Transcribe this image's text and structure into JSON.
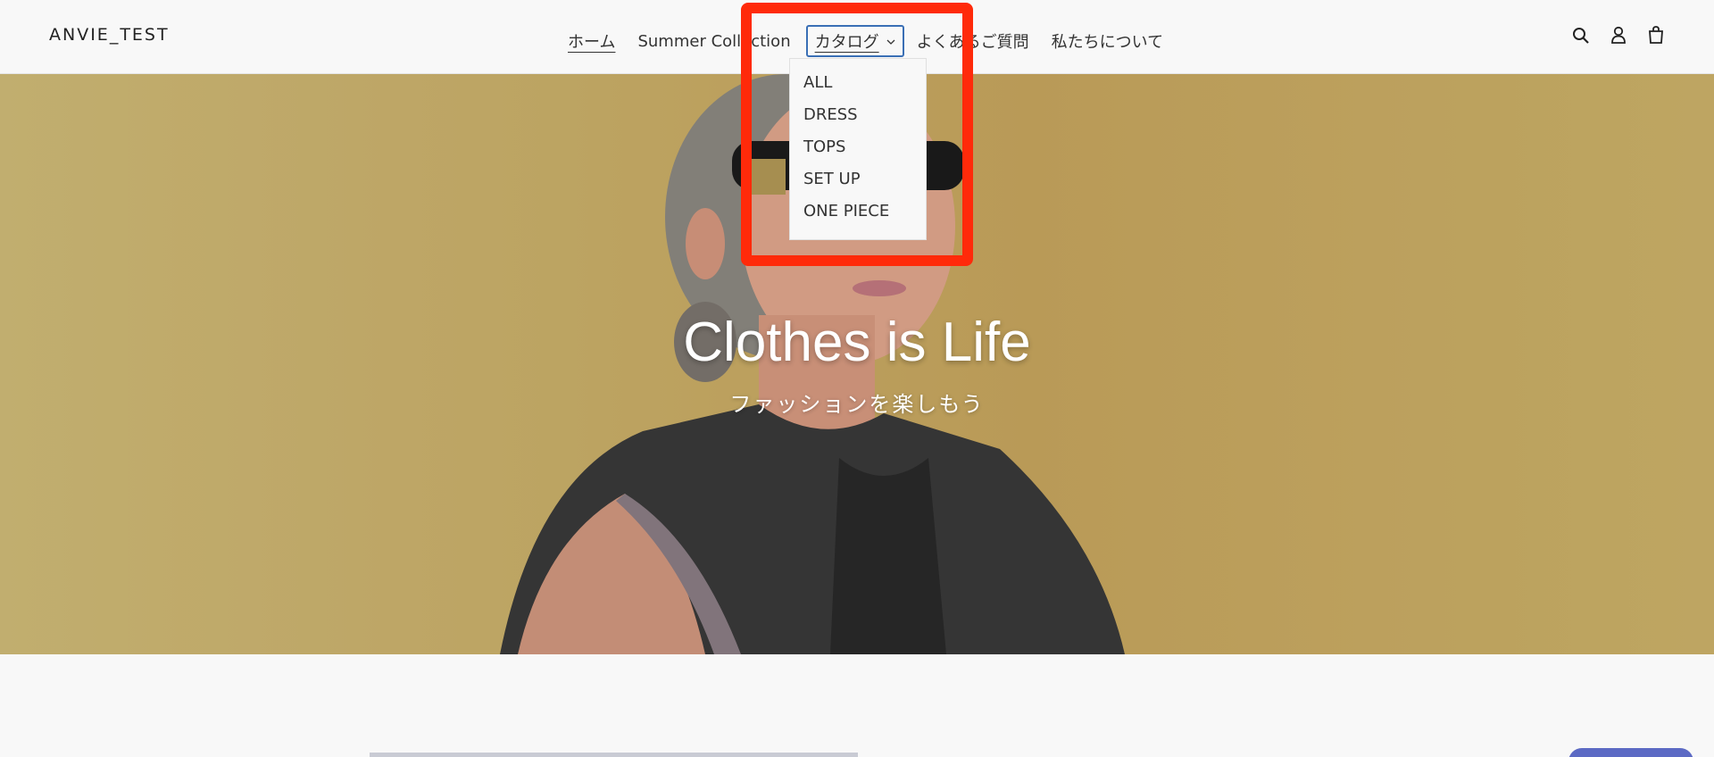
{
  "header": {
    "logo": "ANVIE_TEST",
    "nav": {
      "home": "ホーム",
      "summer": "Summer Collection",
      "catalog": "カタログ",
      "faq": "よくあるご質問",
      "about": "私たちについて"
    }
  },
  "dropdown": {
    "items": [
      "ALL",
      "DRESS",
      "TOPS",
      "SET UP",
      "ONE PIECE"
    ]
  },
  "hero": {
    "title": "Clothes is Life",
    "subtitle": "ファッションを楽しもう"
  },
  "icons": [
    "search-icon",
    "account-icon",
    "cart-icon"
  ],
  "colors": {
    "background": "#f8f8f8",
    "hero": "#cdb16a",
    "annotation": "#ff2a0a",
    "focus": "#3a6fb5"
  }
}
